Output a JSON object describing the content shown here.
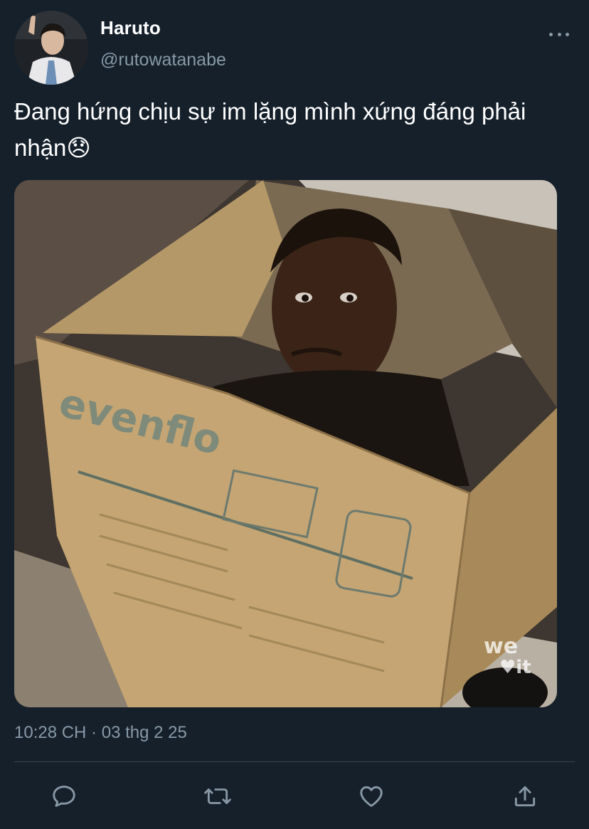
{
  "author": {
    "display_name": "Haruto",
    "handle": "@rutowatanabe",
    "avatar_icon": "profile-photo"
  },
  "tweet": {
    "text_line1": "Đang hứng chịu sự im lặng mình xứng đáng phải",
    "text_line2": "nhận",
    "emoji": "😞",
    "timestamp": "10:28 CH · 03 thg 2 25",
    "media_watermark": "we it"
  },
  "actions": [
    {
      "icon": "reply-icon"
    },
    {
      "icon": "retweet-icon"
    },
    {
      "icon": "like-icon"
    },
    {
      "icon": "share-icon"
    }
  ],
  "colors": {
    "background": "#15202b",
    "secondary_text": "#8899a6",
    "divider": "#38444d"
  }
}
